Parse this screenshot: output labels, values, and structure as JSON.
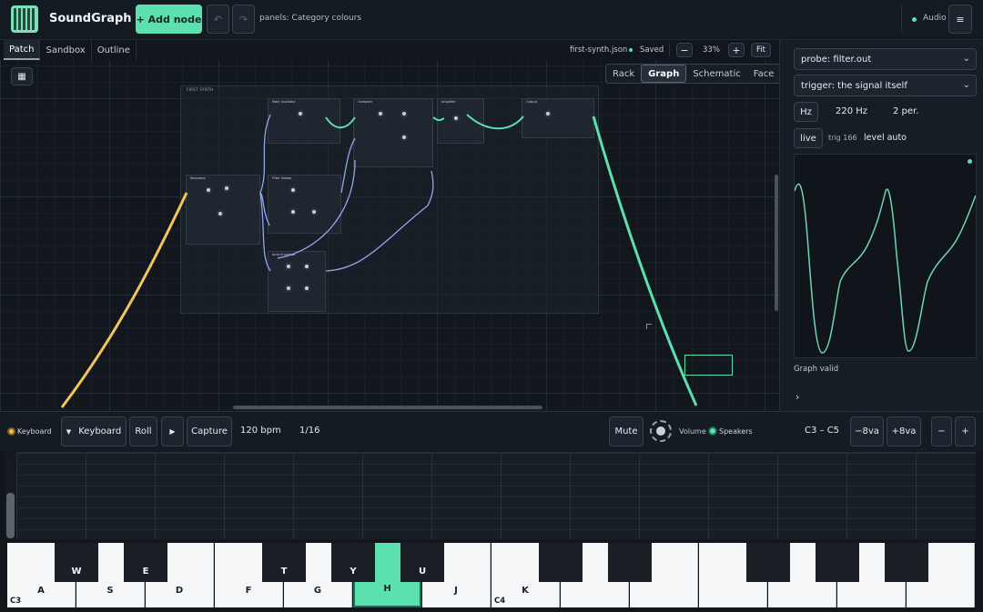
{
  "app": {
    "title": "SoundGraph",
    "add_node": "+ Add node",
    "panels": "panels: Category colours",
    "audio": "Audio",
    "menu_icon": "≡"
  },
  "tabs": [
    "Patch",
    "Sandbox",
    "Outline"
  ],
  "file": {
    "name": "first-synth.json",
    "status": "Saved",
    "zoom": "33%",
    "fit": "Fit",
    "minus": "−",
    "plus": "+"
  },
  "view_modes": [
    "Rack",
    "Graph",
    "Schematic",
    "Face"
  ],
  "active_view": "Graph",
  "graph": {
    "frame_title": "FIRST SYNTH",
    "nodes": [
      "Keyboard",
      "Main Oscillator",
      "Compare",
      "Amplifier",
      "Output",
      "Filter Sweep",
      "Amp Envelope"
    ]
  },
  "probe": {
    "probe_select": "probe: filter.out",
    "trigger_select": "trigger: the signal itself",
    "hz_button": "Hz",
    "frequency": "220 Hz",
    "periods": "2 per.",
    "live_button": "live",
    "trig_count": "trig 166",
    "level": "level auto",
    "status": "Graph valid",
    "expand_icon": "›"
  },
  "bottom": {
    "source": "Keyboard",
    "keyboard_select": "Keyboard",
    "roll": "Roll",
    "play_icon": "▶",
    "capture": "Capture",
    "bpm": "120 bpm",
    "quantize": "1/16",
    "mute": "Mute",
    "volume": "Volume",
    "output": "Speakers",
    "range": "C3 – C5",
    "oct_down": "−8va",
    "oct_up": "+8va",
    "zoom_out": "−",
    "zoom_in": "+"
  },
  "keyboard": {
    "white_keys": [
      {
        "label": "A",
        "note": "C3"
      },
      {
        "label": "S",
        "note": ""
      },
      {
        "label": "D",
        "note": ""
      },
      {
        "label": "F",
        "note": ""
      },
      {
        "label": "G",
        "note": ""
      },
      {
        "label": "H",
        "note": ""
      },
      {
        "label": "J",
        "note": ""
      },
      {
        "label": "K",
        "note": "C4"
      },
      {
        "label": "",
        "note": ""
      },
      {
        "label": "",
        "note": ""
      },
      {
        "label": "",
        "note": ""
      },
      {
        "label": "",
        "note": ""
      },
      {
        "label": "",
        "note": ""
      },
      {
        "label": "",
        "note": ""
      }
    ],
    "black_keys": [
      "W",
      "E",
      "T",
      "Y",
      "U",
      "",
      "",
      "",
      "",
      ""
    ],
    "active_white": 5,
    "active_black": 3
  },
  "colors": {
    "accent": "#5de0b0",
    "cable_yellow": "#f2c45a",
    "cable_blue": "#8fa8f0",
    "background": "#11161d"
  }
}
